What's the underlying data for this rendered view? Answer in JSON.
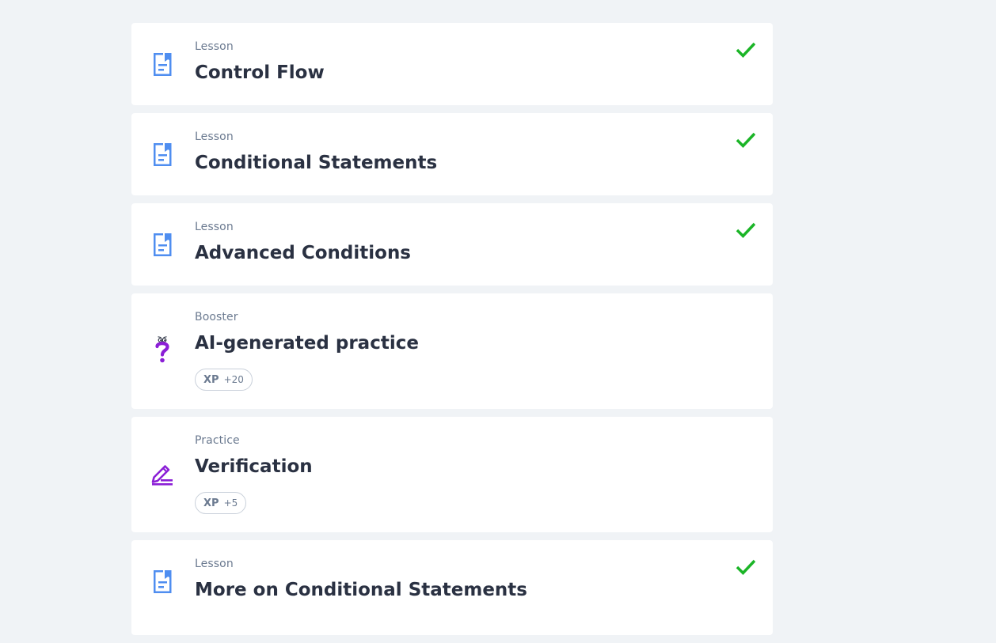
{
  "items": [
    {
      "type": "Lesson",
      "title": "Control Flow",
      "icon": "lesson-doc-icon",
      "completed": true
    },
    {
      "type": "Lesson",
      "title": "Conditional Statements",
      "icon": "lesson-doc-icon",
      "completed": true
    },
    {
      "type": "Lesson",
      "title": "Advanced Conditions",
      "icon": "lesson-doc-icon",
      "completed": true
    },
    {
      "type": "Booster",
      "title": "AI-generated practice",
      "icon": "question-mark-icon",
      "completed": false,
      "xp_label": "XP",
      "xp_value": "+20"
    },
    {
      "type": "Practice",
      "title": "Verification",
      "icon": "pencil-edit-icon",
      "completed": false,
      "xp_label": "XP",
      "xp_value": "+5"
    },
    {
      "type": "Lesson",
      "title": "More on Conditional Statements",
      "icon": "lesson-doc-icon",
      "completed": true
    }
  ],
  "colors": {
    "background": "#f0f3f6",
    "card": "#ffffff",
    "lesson_icon": "#4f8ef0",
    "booster_icon": "#8b1fd6",
    "practice_icon": "#8b1fd6",
    "check": "#1bb527",
    "title": "#2a3142",
    "type_text": "#6b7a90"
  }
}
